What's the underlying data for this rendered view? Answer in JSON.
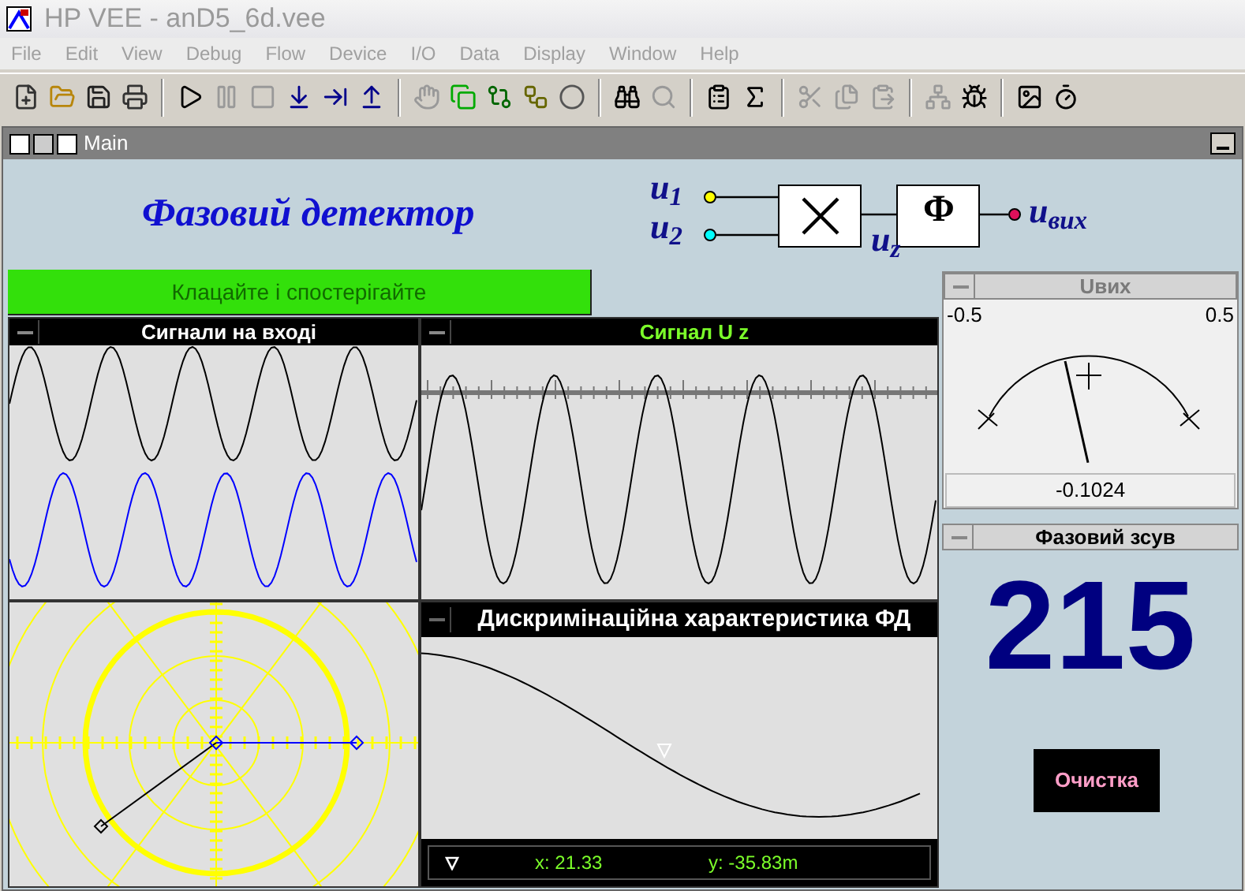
{
  "window": {
    "title": "HP VEE - anD5_6d.vee"
  },
  "menu": [
    "File",
    "Edit",
    "View",
    "Debug",
    "Flow",
    "Device",
    "I/O",
    "Data",
    "Display",
    "Window",
    "Help"
  ],
  "subwindow": {
    "title": "Main"
  },
  "heading": "Фазовий детектор",
  "diagram": {
    "inputs": [
      "u$_{1}$",
      "u$_{2}$"
    ],
    "filter": "Φ",
    "product": "u$_{z}$",
    "output": "u$_{вих}$"
  },
  "start_button": "Клацайте і спостерігайте",
  "input_signals": {
    "title": "Сигнали на вході"
  },
  "uz_signal": {
    "title": "Сигнал U z"
  },
  "meter": {
    "title": "Uвих",
    "min_label": "-0.5",
    "max_label": "0.5",
    "level": 0.3976,
    "reading": "-0.1024"
  },
  "discriminator": {
    "title": "Дискримінаційна характеристика ФД",
    "x_readout": "x: 21.33",
    "y_readout": "y: -35.83m"
  },
  "phase_shift": {
    "title": "Фазовий зсув",
    "value": "215"
  },
  "clear_button": "Очистка"
}
